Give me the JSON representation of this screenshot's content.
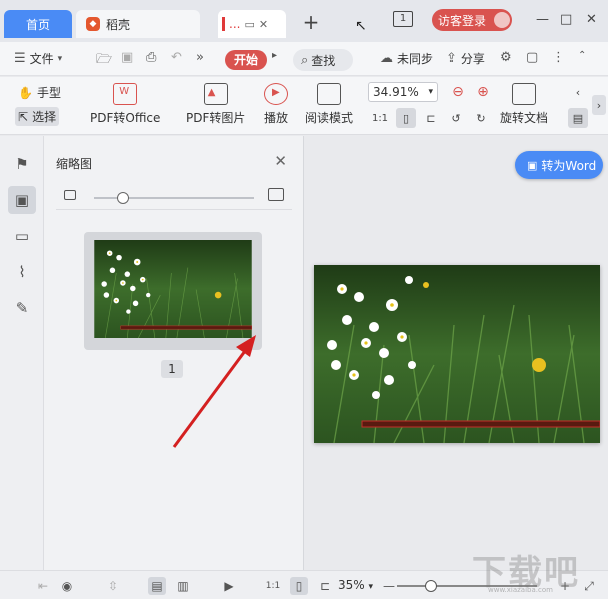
{
  "tabs": {
    "home": "首页",
    "daoke": "稻壳",
    "doc": "...",
    "add": "+"
  },
  "titlebar": {
    "page_indicator": "1",
    "visitor_login": "访客登录"
  },
  "menubar": {
    "file": "文件",
    "start": "开始",
    "find": "查找",
    "unsynced": "未同步",
    "share": "分享"
  },
  "toolbar": {
    "hand": "手型",
    "select": "选择",
    "pdf_to_office": "PDF转Office",
    "pdf_to_image": "PDF转图片",
    "play": "播放",
    "read_mode": "阅读模式",
    "zoom": "34.91%",
    "rotate_doc": "旋转文档",
    "actual_size": "1:1"
  },
  "panel": {
    "title": "缩略图",
    "page_number": "1",
    "size_level": 0.18
  },
  "canvas": {
    "to_word": "转为Word"
  },
  "statusbar": {
    "actual_size": "1:1",
    "zoom": "35%",
    "zoom_level": 0.24
  },
  "watermark": {
    "text": "下载吧",
    "sub": "www.xiazaiba.com"
  },
  "colors": {
    "accent_blue": "#4a8bf5",
    "accent_red": "#d9534f",
    "grass": "#3a6a2a"
  }
}
